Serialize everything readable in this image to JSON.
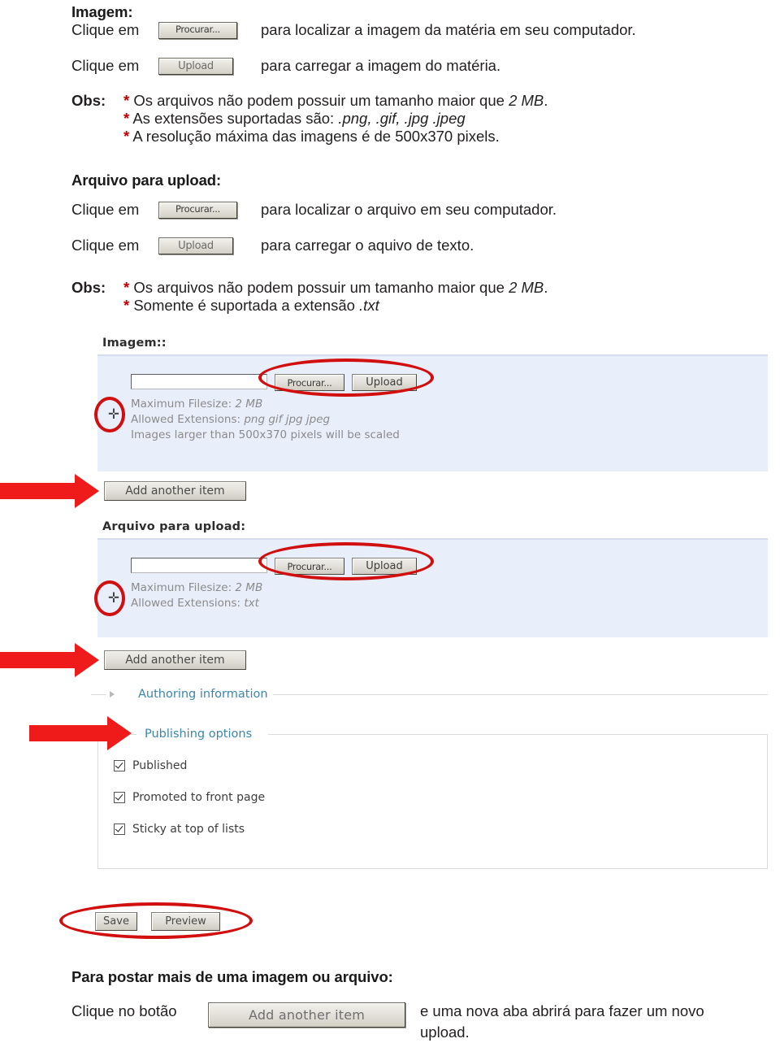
{
  "top": {
    "image_section": {
      "title": "Imagem:",
      "row1": {
        "prefix": "Clique em",
        "button": "Procurar...",
        "suffix": "para localizar a imagem da matéria em seu computador."
      },
      "row2": {
        "prefix": "Clique em",
        "button": "Upload",
        "suffix": "para carregar a imagem do matéria."
      },
      "obs_label": "Obs:",
      "obs": [
        {
          "bullet": "*",
          "text_before": "Os arquivos não podem possuir um tamanho maior que ",
          "emphasis": "2 MB",
          "text_after": "."
        },
        {
          "bullet": "*",
          "text_before": "As extensões suportadas são: ",
          "emphasis": ".png, .gif, .jpg .jpeg",
          "text_after": ""
        },
        {
          "bullet": "*",
          "text_before": "A resolução máxima das imagens é de 500x370 pixels.",
          "emphasis": "",
          "text_after": ""
        }
      ]
    },
    "file_section": {
      "title": "Arquivo para upload:",
      "row1": {
        "prefix": "Clique em",
        "button": "Procurar...",
        "suffix": "para localizar o arquivo em seu computador."
      },
      "row2": {
        "prefix": "Clique em",
        "button": "Upload",
        "suffix": "para carregar o aquivo de texto."
      },
      "obs_label": "Obs:",
      "obs": [
        {
          "bullet": "*",
          "text_before": "Os arquivos não podem possuir um tamanho maior que ",
          "emphasis": "2 MB",
          "text_after": "."
        },
        {
          "bullet": "*",
          "text_before": "Somente é suportada a extensão ",
          "emphasis": ".txt",
          "text_after": ""
        }
      ]
    }
  },
  "screenshot": {
    "image_panel": {
      "label": "Imagem::",
      "browse_button": "Procurar...",
      "upload_button": "Upload",
      "hints": [
        {
          "label": "Maximum Filesize:",
          "value": "2 MB"
        },
        {
          "label": "Allowed Extensions:",
          "value": "png gif jpg jpeg"
        },
        {
          "label": "Images larger than 500x370 pixels will be scaled",
          "value": ""
        }
      ]
    },
    "add_another_item_1": "Add another item",
    "file_panel": {
      "label": "Arquivo para upload:",
      "browse_button": "Procurar...",
      "upload_button": "Upload",
      "hints": [
        {
          "label": "Maximum Filesize:",
          "value": "2 MB"
        },
        {
          "label": "Allowed Extensions:",
          "value": "txt"
        }
      ]
    },
    "add_another_item_2": "Add another item",
    "groups": {
      "authoring": "Authoring information",
      "publishing": "Publishing options"
    },
    "checkboxes": [
      {
        "label": "Published",
        "checked": true
      },
      {
        "label": "Promoted to front page",
        "checked": true
      },
      {
        "label": "Sticky at top of lists",
        "checked": true
      }
    ],
    "actions": {
      "save": "Save",
      "preview": "Preview"
    }
  },
  "footer": {
    "title": "Para postar mais de uma imagem ou arquivo:",
    "prefix": "Clique no botão",
    "button": "Add another item",
    "suffix": "e uma nova aba abrirá para fazer um novo upload."
  },
  "colors": {
    "annotation_red": "#ef1b1b",
    "ellipse_red": "#d10f0f",
    "asterisk_red": "#c00000",
    "panel_background": "#e9eefb",
    "group_link": "#3a87ad",
    "hint_gray": "#8b8b8b"
  }
}
